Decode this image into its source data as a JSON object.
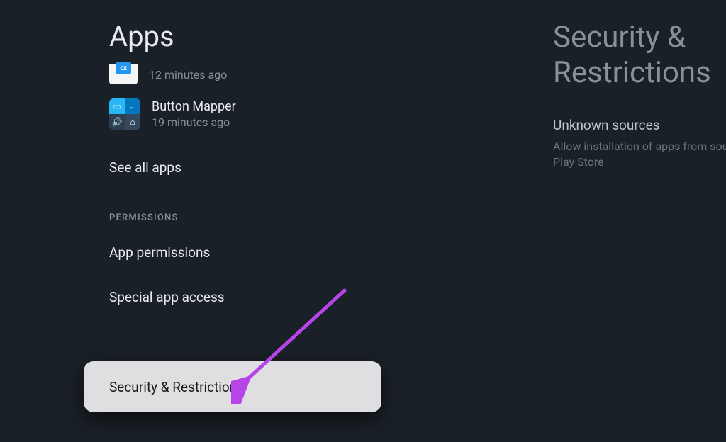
{
  "left": {
    "title": "Apps",
    "recent_apps": [
      {
        "name": "",
        "time": "12 minutes ago",
        "icon_text": "cx"
      },
      {
        "name": "Button Mapper",
        "time": "19 minutes ago"
      }
    ],
    "see_all": "See all apps",
    "section_header": "PERMISSIONS",
    "items": [
      "App permissions",
      "Special app access",
      "Security & Restrictions"
    ]
  },
  "right": {
    "title": "Security & Restrictions",
    "option_title": "Unknown sources",
    "option_desc": "Allow installation of apps from sources other than the Play Store"
  },
  "annotation": {
    "color": "#b744e8"
  }
}
